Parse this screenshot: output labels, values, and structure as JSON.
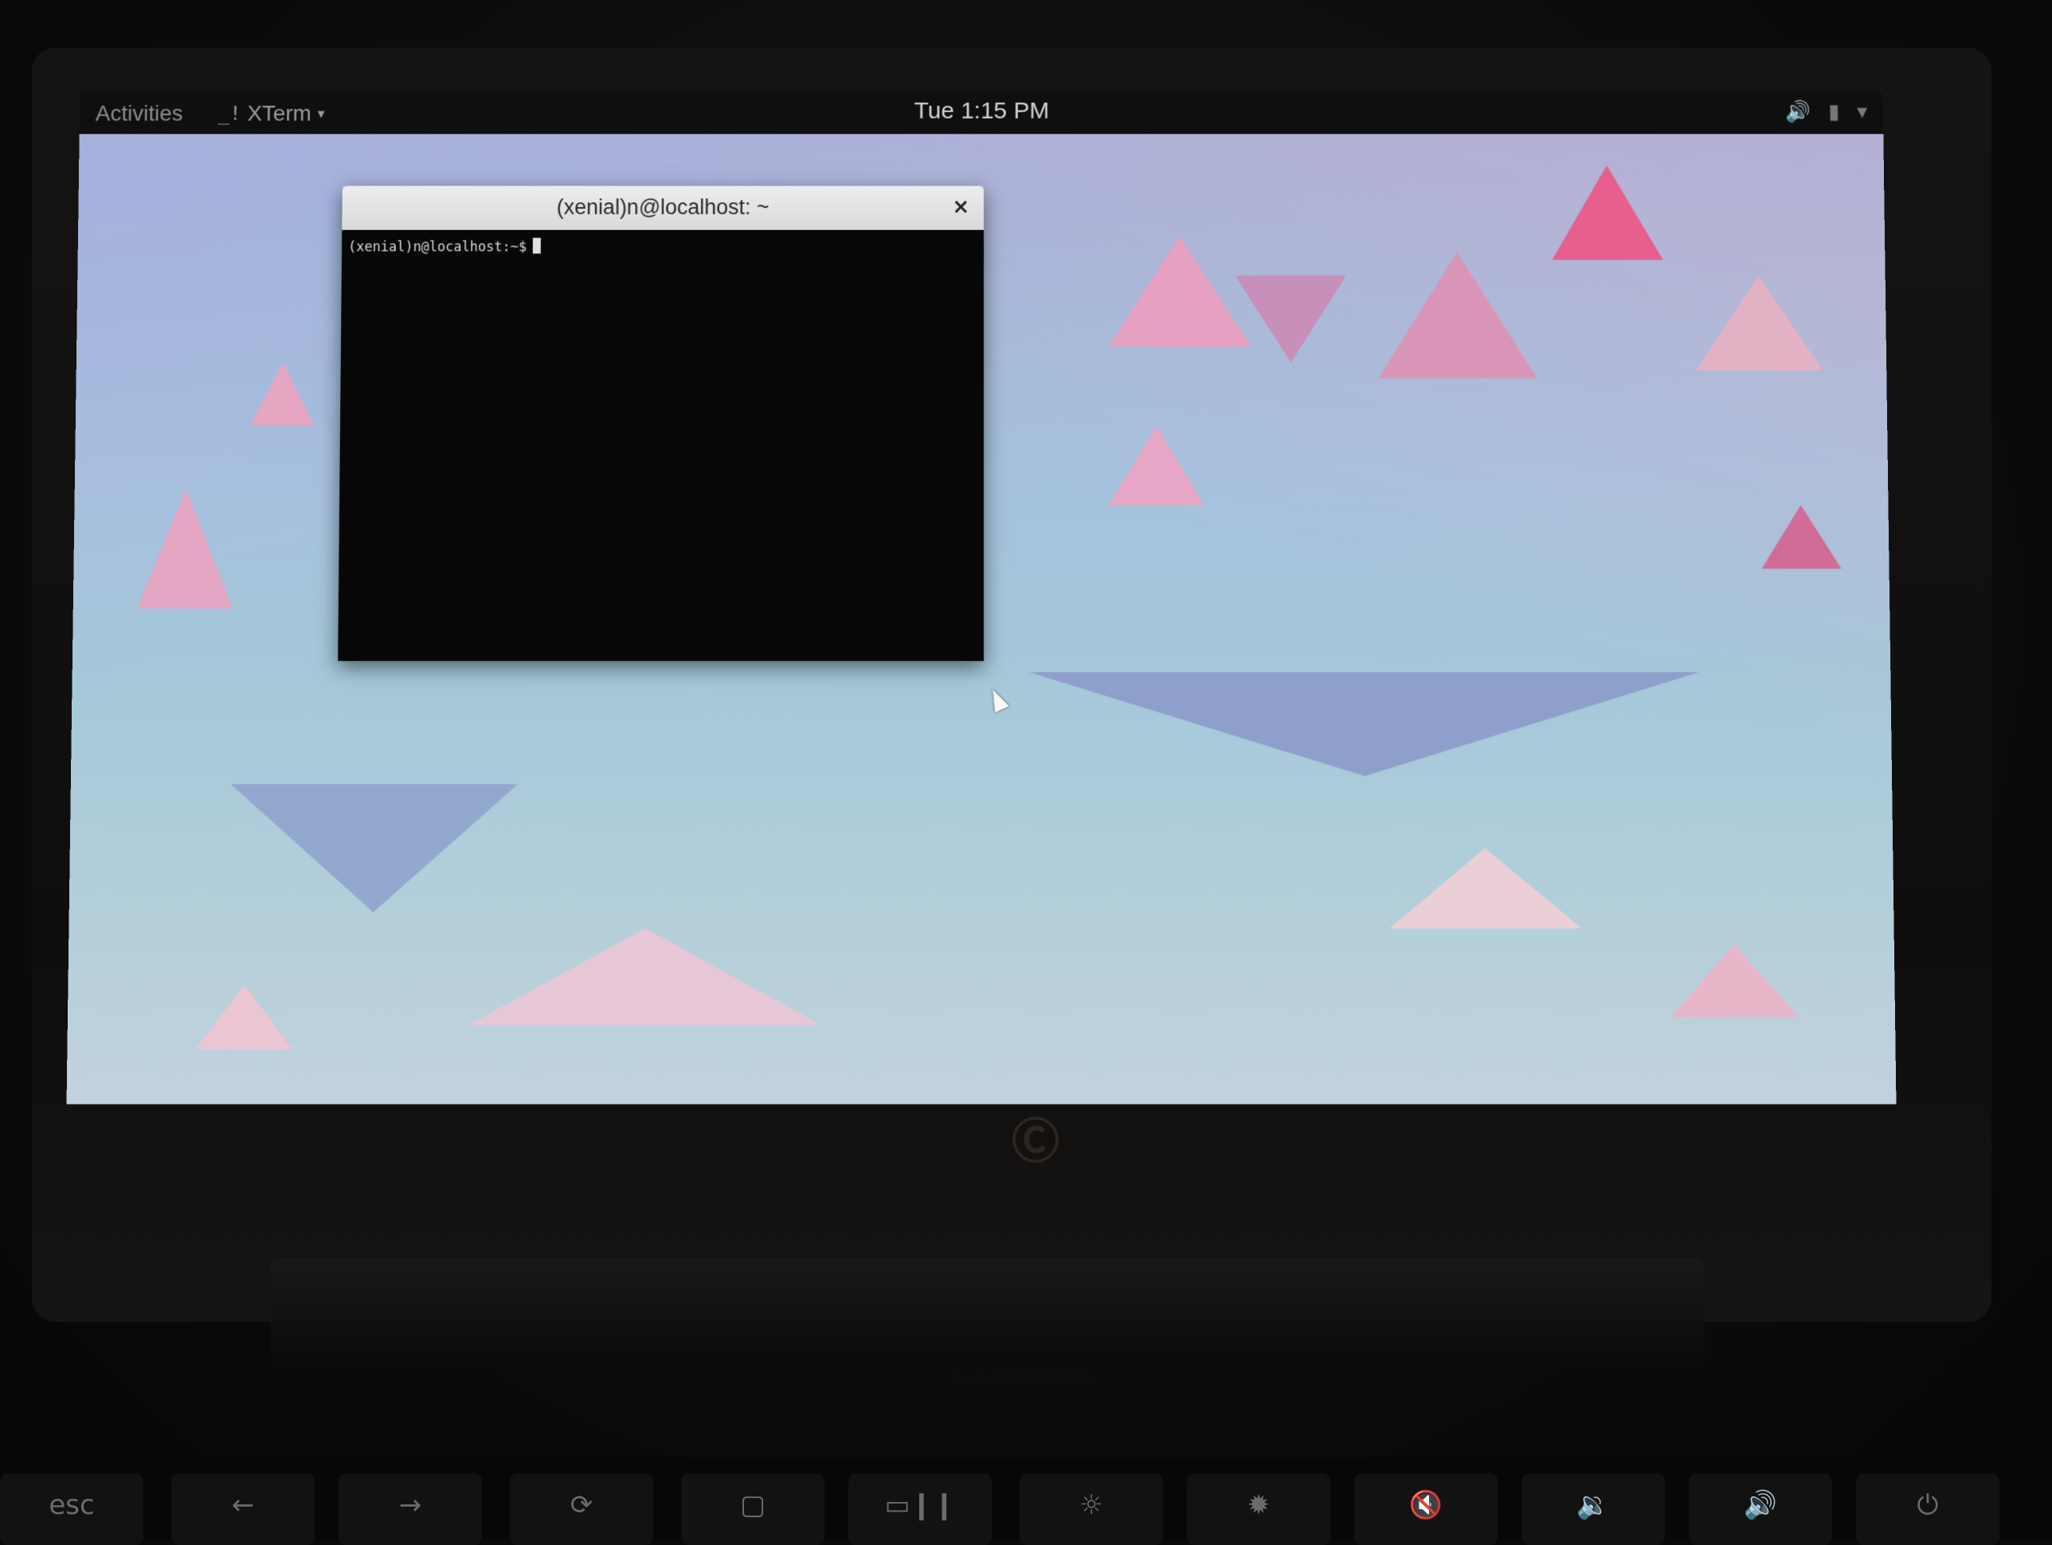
{
  "topbar": {
    "activities_label": "Activities",
    "app_menu_label": "XTerm",
    "app_menu_icon": "terminal-icon",
    "clock": "Tue  1:15 PM",
    "status_icons": [
      "volume-icon",
      "battery-icon",
      "system-menu-caret-icon"
    ]
  },
  "xterm": {
    "title": "(xenial)n@localhost: ~",
    "close_glyph": "×",
    "prompt": "(xenial)n@localhost:~$"
  },
  "keyboard": {
    "keys": [
      {
        "name": "esc-key",
        "label": "esc"
      },
      {
        "name": "back-key",
        "label": "←"
      },
      {
        "name": "forward-key",
        "label": "→"
      },
      {
        "name": "refresh-key",
        "label": "⟳"
      },
      {
        "name": "fullscreen-key",
        "label": "▢"
      },
      {
        "name": "overview-key",
        "label": "▭❙❙"
      },
      {
        "name": "brightness-down-key",
        "label": "☼"
      },
      {
        "name": "brightness-up-key",
        "label": "✹"
      },
      {
        "name": "mute-key",
        "label": "🔇"
      },
      {
        "name": "volume-down-key",
        "label": "🔉"
      },
      {
        "name": "volume-up-key",
        "label": "🔊"
      },
      {
        "name": "power-key",
        "label": "⏻"
      }
    ]
  }
}
